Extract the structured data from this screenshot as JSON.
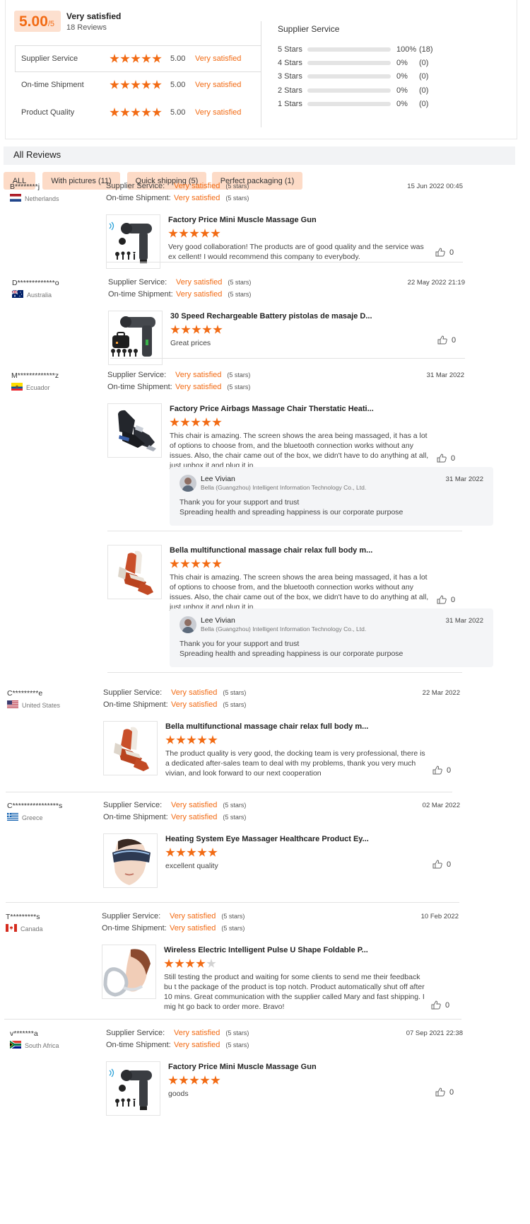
{
  "summary": {
    "score": "5.00",
    "score_suffix": "/5",
    "verdict": "Very satisfied",
    "review_count": "18 Reviews",
    "metrics": [
      {
        "label": "Supplier Service",
        "value": "5.00",
        "verdict": "Very satisfied",
        "stars": 5
      },
      {
        "label": "On-time Shipment",
        "value": "5.00",
        "verdict": "Very satisfied",
        "stars": 5
      },
      {
        "label": "Product Quality",
        "value": "5.00",
        "verdict": "Very satisfied",
        "stars": 5
      }
    ],
    "distribution_title": "Supplier Service",
    "distribution": [
      {
        "label": "5 Stars",
        "percent": "100%",
        "count": "(18)",
        "fraction": 1.0
      },
      {
        "label": "4 Stars",
        "percent": "0%",
        "count": "(0)",
        "fraction": 0
      },
      {
        "label": "3 Stars",
        "percent": "0%",
        "count": "(0)",
        "fraction": 0
      },
      {
        "label": "2 Stars",
        "percent": "0%",
        "count": "(0)",
        "fraction": 0
      },
      {
        "label": "1 Stars",
        "percent": "0%",
        "count": "(0)",
        "fraction": 0
      }
    ]
  },
  "reviews_header": "All Reviews",
  "filters": [
    "ALL",
    "With pictures (11)",
    "Quick shipping (5)",
    "Perfect packaging (1)"
  ],
  "labels": {
    "supplier_service": "Supplier Service:",
    "ontime_shipment": "On-time Shipment:",
    "very_satisfied": "Very satisfied",
    "five_stars": "(5 stars)"
  },
  "colors": {
    "accent": "#f26b14",
    "filter_bg": "#fddbc7",
    "score_bg": "#fde0cf"
  },
  "reviews": [
    {
      "name": "B********j",
      "country": "Netherlands",
      "flag": "netherlands",
      "date": "15 Jun 2022 00:45",
      "products": [
        {
          "title": "Factory Price Mini Muscle Massage Gun",
          "stars": 5,
          "image": "massage-gun",
          "text": "Very good collaboration! The products are of good quality and the service was ex cellent! I would recommend this company to everybody.",
          "likes": "0"
        }
      ]
    },
    {
      "name": "D*************o",
      "country": "Australia",
      "flag": "australia",
      "date": "22 May 2022 21:19",
      "products": [
        {
          "title": "30 Speed Rechargeable Battery pistolas de masaje D...",
          "stars": 5,
          "image": "massage-gun-kit",
          "text": "Great prices",
          "likes": "0"
        }
      ]
    },
    {
      "name": "M*************z",
      "country": "Ecuador",
      "flag": "ecuador",
      "date": "31 Mar 2022",
      "products": [
        {
          "title": "Factory Price Airbags Massage Chair Therstatic Heati...",
          "stars": 5,
          "image": "massage-chair-black",
          "text": "This chair is amazing. The screen shows the area being massaged, it has a lot of options to choose from, and the bluetooth connection works without any issues. Also, the chair came out of the box, we didn't have to do anything at all, just unbox it and plug it in.",
          "likes": "0",
          "reply": {
            "name": "Lee Vivian",
            "company": "Bella (Guangzhou) Intelligent Information Technology Co., Ltd.",
            "date": "31 Mar 2022",
            "line1": "Thank you for your support and trust",
            "line2": "Spreading health and spreading happiness is our corporate purpose"
          }
        },
        {
          "title": "Bella multifunctional massage chair relax full body m...",
          "stars": 5,
          "image": "massage-chair-orange",
          "text": "This chair is amazing. The screen shows the area being massaged, it has a lot of options to choose from, and the bluetooth connection works without any issues. Also, the chair came out of the box, we didn't have to do anything at all, just unbox it and plug it in.",
          "likes": "0",
          "reply": {
            "name": "Lee Vivian",
            "company": "Bella (Guangzhou) Intelligent Information Technology Co., Ltd.",
            "date": "31 Mar 2022",
            "line1": "Thank you for your support and trust",
            "line2": "Spreading health and spreading happiness is our corporate purpose"
          }
        }
      ]
    },
    {
      "name": "C*********e",
      "country": "United States",
      "flag": "usa",
      "date": "22 Mar 2022",
      "products": [
        {
          "title": "Bella multifunctional massage chair relax full body m...",
          "stars": 5,
          "image": "massage-chair-orange",
          "text": "The product quality is very good, the docking team is very professional, there is a dedicated after-sales team to deal with my problems, thank you very much vivian, and look forward to our next cooperation",
          "likes": "0"
        }
      ]
    },
    {
      "name": "C****************s",
      "country": "Greece",
      "flag": "greece",
      "date": "02 Mar 2022",
      "products": [
        {
          "title": "Heating System Eye Massager Healthcare Product Ey...",
          "stars": 5,
          "image": "eye-massager",
          "text": "excellent quality",
          "likes": "0"
        }
      ]
    },
    {
      "name": "T*********s",
      "country": "Canada",
      "flag": "canada",
      "date": "10 Feb 2022",
      "products": [
        {
          "title": "Wireless Electric Intelligent Pulse U Shape Foldable P...",
          "stars": 4,
          "image": "neck-massager",
          "text": "Still testing the product and waiting for some clients to send me their feedback bu t the package of the product is top notch. Product automatically shut off after 10 mins. Great communication with the supplier called Mary and fast shipping. I mig ht go back to order more. Bravo!",
          "likes": "0"
        }
      ]
    },
    {
      "name": "v*******a",
      "country": "South Africa",
      "flag": "south-africa",
      "date": "07 Sep 2021 22:38",
      "products": [
        {
          "title": "Factory Price Mini Muscle Massage Gun",
          "stars": 5,
          "image": "massage-gun",
          "text": "goods",
          "likes": "0"
        }
      ]
    }
  ]
}
